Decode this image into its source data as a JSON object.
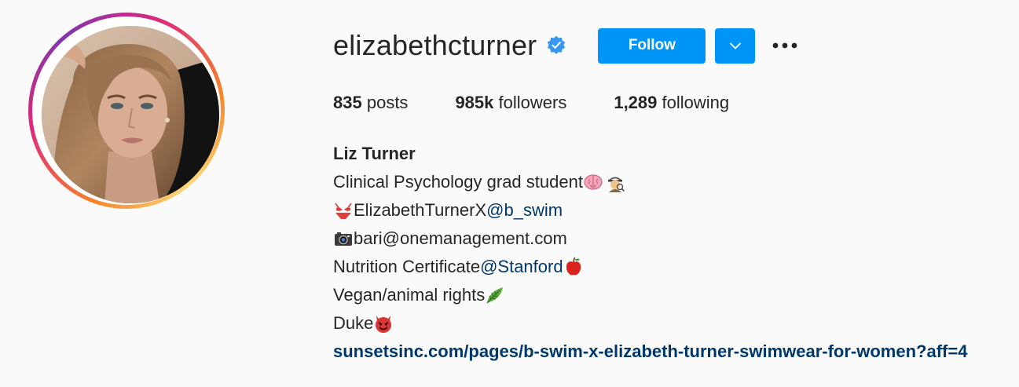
{
  "profile": {
    "username": "elizabethcturner",
    "full_name": "Liz Turner",
    "verified": true
  },
  "actions": {
    "follow_label": "Follow",
    "dropdown_icon": "chevron-down-icon",
    "more_icon": "more-options-icon"
  },
  "stats": {
    "posts_count": "835",
    "posts_label": "posts",
    "followers_count": "985k",
    "followers_label": "followers",
    "following_count": "1,289",
    "following_label": "following"
  },
  "bio": {
    "line1_text": "Clinical Psychology grad student",
    "line1_emojis": [
      "brain-emoji",
      "detective-emoji"
    ],
    "line2_prefix_emoji": "bikini-emoji",
    "line2_text": "ElizabethTurnerX ",
    "line2_mention": "@b_swim",
    "line3_prefix_emoji": "camera-emoji",
    "line3_text": " bari@onemanagement.com",
    "line4_text": "Nutrition Certificate ",
    "line4_mention": "@Stanford",
    "line4_emoji": "apple-emoji",
    "line5_text": "Vegan/animal rights",
    "line5_emoji": "leaf-emoji",
    "line6_text": "Duke ",
    "line6_emoji": "devil-emoji",
    "link": "sunsetsinc.com/pages/b-swim-x-elizabeth-turner-swimwear-for-women?aff=4"
  },
  "colors": {
    "accent": "#0095f6",
    "mention": "#00376b",
    "background": "#fafafa",
    "text": "#262626"
  }
}
